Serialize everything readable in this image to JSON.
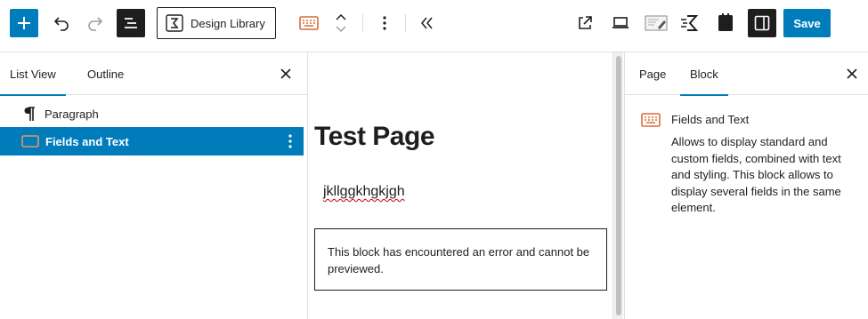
{
  "toolbar": {
    "design_library_label": "Design Library",
    "save_label": "Save"
  },
  "left_panel": {
    "tabs": [
      "List View",
      "Outline"
    ],
    "items": [
      {
        "label": "Paragraph"
      },
      {
        "label": "Fields and Text"
      }
    ]
  },
  "canvas": {
    "title": "Test Page",
    "paragraph": "jkllggkhgkjgh",
    "error_message": "This block has encountered an error and cannot be previewed."
  },
  "right_panel": {
    "tabs": [
      "Page",
      "Block"
    ],
    "block_title": "Fields and Text",
    "block_description": "Allows to display standard and custom fields, combined with text and styling. This block allows to display several fields in the same element."
  },
  "colors": {
    "accent": "#007cba",
    "dark": "#1e1e1e",
    "block_icon": "#d86c3a"
  },
  "icons": [
    "plus-icon",
    "undo-icon",
    "redo-icon",
    "list-view-icon",
    "design-library-icon",
    "keyboard-block-icon",
    "chevron-up-icon",
    "chevron-down-icon",
    "more-vertical-icon",
    "collapse-icon",
    "external-link-icon",
    "desktop-icon",
    "edit-screen-icon",
    "speed-icon",
    "clipboard-icon",
    "sidebar-icon",
    "close-icon",
    "paragraph-icon"
  ]
}
